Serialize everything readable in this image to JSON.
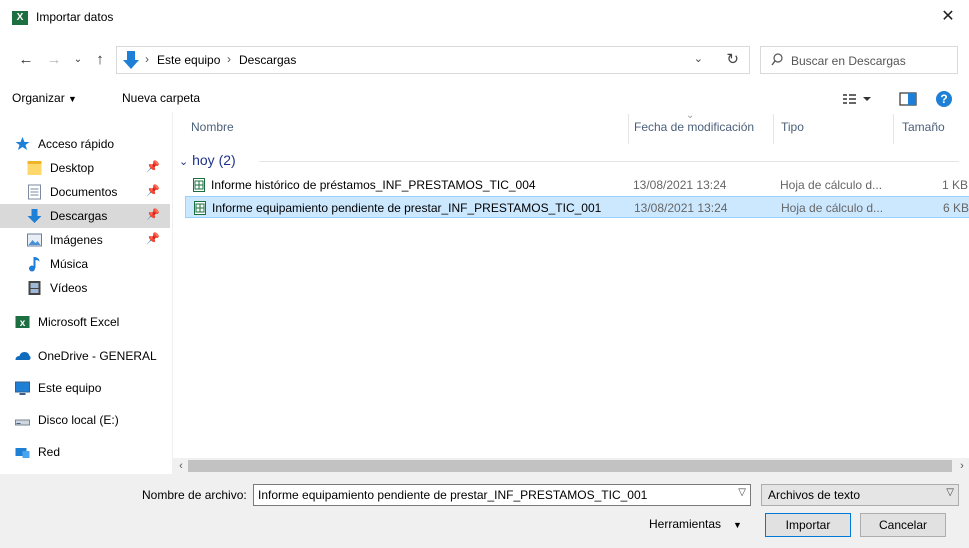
{
  "window": {
    "title": "Importar datos",
    "app_icon_letter": "X"
  },
  "address": {
    "crumbs": [
      "Este equipo",
      "Descargas"
    ]
  },
  "search": {
    "placeholder": "Buscar en Descargas"
  },
  "toolbar": {
    "organize": "Organizar",
    "new_folder": "Nueva carpeta"
  },
  "sidebar": {
    "items": [
      {
        "label": "Acceso rápido",
        "icon": "star-icon"
      },
      {
        "label": "Desktop",
        "icon": "folder-icon",
        "pinned": true
      },
      {
        "label": "Documentos",
        "icon": "documents-icon",
        "pinned": true
      },
      {
        "label": "Descargas",
        "icon": "downloads-icon",
        "pinned": true,
        "active": true
      },
      {
        "label": "Imágenes",
        "icon": "pictures-icon",
        "pinned": true
      },
      {
        "label": "Música",
        "icon": "music-icon"
      },
      {
        "label": "Vídeos",
        "icon": "videos-icon"
      },
      {
        "label": "Microsoft Excel",
        "icon": "excel-icon"
      },
      {
        "label": "OneDrive - GENERAL",
        "icon": "onedrive-icon"
      },
      {
        "label": "Este equipo",
        "icon": "computer-icon"
      },
      {
        "label": "Disco local (E:)",
        "icon": "drive-icon"
      },
      {
        "label": "Red",
        "icon": "network-icon"
      }
    ]
  },
  "columns": {
    "name": "Nombre",
    "modified": "Fecha de modificación",
    "type": "Tipo",
    "size": "Tamaño"
  },
  "group": {
    "label": "hoy (2)"
  },
  "files": [
    {
      "name": "Informe histórico de préstamos_INF_PRESTAMOS_TIC_004",
      "modified": "13/08/2021 13:24",
      "type": "Hoja de cálculo d...",
      "size": "1 KB",
      "selected": false
    },
    {
      "name": "Informe equipamiento pendiente de prestar_INF_PRESTAMOS_TIC_001",
      "modified": "13/08/2021 13:24",
      "type": "Hoja de cálculo d...",
      "size": "6 KB",
      "selected": true
    }
  ],
  "footer": {
    "filename_label": "Nombre de archivo:",
    "filename_value": "Informe equipamiento pendiente de prestar_INF_PRESTAMOS_TIC_001",
    "filetype_value": "Archivos de texto",
    "tools_label": "Herramientas",
    "import_label": "Importar",
    "cancel_label": "Cancelar"
  },
  "colors": {
    "excel_green": "#1d6f42",
    "selection_bg": "#cce8ff",
    "selection_border": "#99d1ff",
    "accent": "#0078d7",
    "group_header": "#1e3287"
  }
}
